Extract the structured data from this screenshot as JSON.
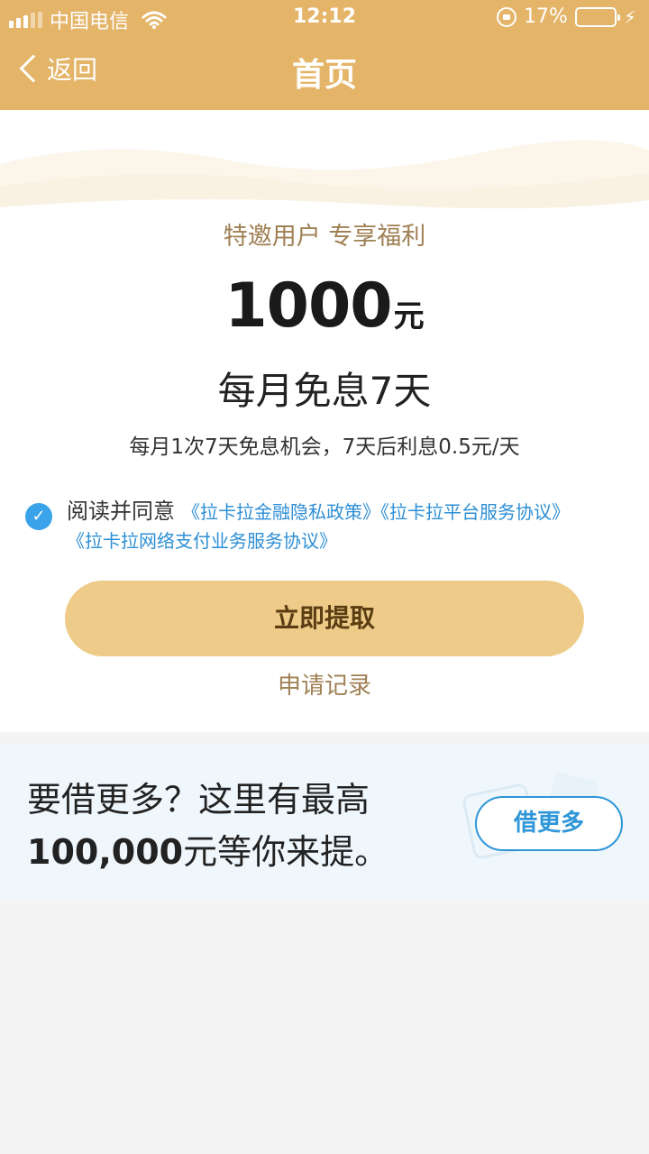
{
  "status_bar": {
    "carrier": "中国电信",
    "time": "12:12",
    "battery_percent": "17%",
    "battery_level": 0.17
  },
  "nav": {
    "back_label": "返回",
    "title": "首页"
  },
  "offer": {
    "subtitle": "特邀用户 专享福利",
    "amount": "1000",
    "unit": "元",
    "headline": "每月免息7天",
    "description": "每月1次7天免息机会，7天后利息0.5元/天"
  },
  "agreement": {
    "checked": true,
    "prefix": "阅读并同意",
    "links": [
      "《拉卡拉金融隐私政策》",
      "《拉卡拉平台服务协议》",
      "《拉卡拉网络支付业务服务协议》"
    ]
  },
  "actions": {
    "primary_label": "立即提取",
    "records_label": "申请记录"
  },
  "promo": {
    "line1": "要借更多？这里有最高",
    "line2_amount": "100,000",
    "line2_rest": "元等你来提。",
    "button_label": "借更多"
  },
  "colors": {
    "header": "#e4b468",
    "primary_button": "#eecb88",
    "link": "#2d8fd6",
    "accent_text": "#a08055"
  }
}
